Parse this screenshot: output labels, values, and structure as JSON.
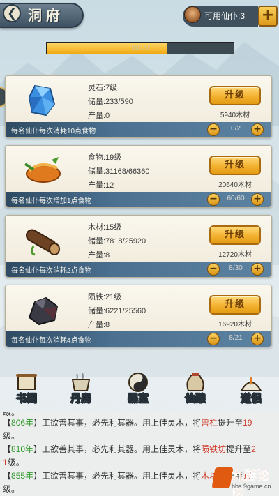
{
  "header": {
    "back_icon": "back-arrow-icon",
    "title": "洞府",
    "available_spirits_label": "可用仙仆:3",
    "add_icon": "plus-icon"
  },
  "progress": {
    "label": "00:00",
    "fraction": 0.64
  },
  "resources": [
    {
      "icon": "spirit-stone-icon",
      "name_level": "灵石:7级",
      "storage": "储量:233/590",
      "output": "产量:0",
      "upgrade_label": "升级",
      "cost": "5940木材",
      "footer": "每名仙仆每次消耗10点食物",
      "workers": "0/2"
    },
    {
      "icon": "food-icon",
      "name_level": "食物:19级",
      "storage": "储量:31168/66360",
      "output": "产量:12",
      "upgrade_label": "升级",
      "cost": "20640木材",
      "footer": "每名仙仆每次增加1点食物",
      "workers": "60/60"
    },
    {
      "icon": "wood-log-icon",
      "name_level": "木材:15级",
      "storage": "储量:7818/25920",
      "output": "产量:8",
      "upgrade_label": "升级",
      "cost": "12720木材",
      "footer": "每名仙仆每次消耗2点食物",
      "workers": "8/30"
    },
    {
      "icon": "meteorite-iron-icon",
      "name_level": "陨铁:21级",
      "storage": "储量:6221/25560",
      "output": "产量:8",
      "upgrade_label": "升级",
      "cost": "16920木材",
      "footer": "每名仙仆每次消耗4点食物",
      "workers": "8/21"
    }
  ],
  "nav": [
    {
      "label": "书阁",
      "icon": "scroll-icon"
    },
    {
      "label": "丹房",
      "icon": "cauldron-icon"
    },
    {
      "label": "器室",
      "icon": "taiji-icon"
    },
    {
      "label": "仙酿",
      "icon": "wine-jar-icon"
    },
    {
      "label": "道侣",
      "icon": "companion-icon"
    }
  ],
  "log": [
    {
      "prefix": "【",
      "year": "806年",
      "mid": "】工欲善其事，必先利其器。用上佳灵木，将",
      "building": "兽栏",
      "suffix": "提升至",
      "level_a": "19",
      "level_b": "",
      "tail": "级。"
    },
    {
      "prefix": "【",
      "year": "810年",
      "mid": "】工欲善其事，必先利其器。用上佳灵木，将",
      "building": "陨铁坊",
      "suffix": "提升至",
      "level_a": "2",
      "level_b": "1",
      "tail": "级。"
    },
    {
      "prefix": "【",
      "year": "855年",
      "mid": "】工欲善其事，必先利其器。用上佳灵木，将",
      "building": "木坊",
      "suffix": "提升至",
      "level_a": "15",
      "level_b": "",
      "tail": "级。"
    }
  ],
  "log_partial_top": "级。",
  "watermark": {
    "title": "九游论坛",
    "url": "bbs.9game.cn"
  },
  "colors": {
    "button_gold": "#f3b231",
    "footer_blue": "#4b7090",
    "year_green": "#2f9a2b",
    "highlight_red": "#cf3a2b"
  }
}
